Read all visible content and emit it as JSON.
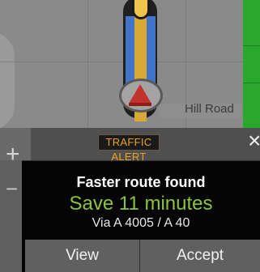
{
  "map": {
    "street_label": "Hill Road"
  },
  "alert": {
    "tag": "TRAFFIC ALERT",
    "title": "Faster route found",
    "savings": "Save 11 minutes",
    "via": "Via A 4005 / A 40"
  },
  "controls": {
    "zoom_in": "+",
    "zoom_out": "−",
    "close": "×"
  },
  "buttons": {
    "view": "View",
    "accept": "Accept"
  },
  "colors": {
    "alert_orange": "#f0a11b",
    "savings_green": "#89c53d",
    "route_blue": "#3f74c9",
    "traffic_green": "#2aa82e",
    "position_red": "#c2322c"
  }
}
